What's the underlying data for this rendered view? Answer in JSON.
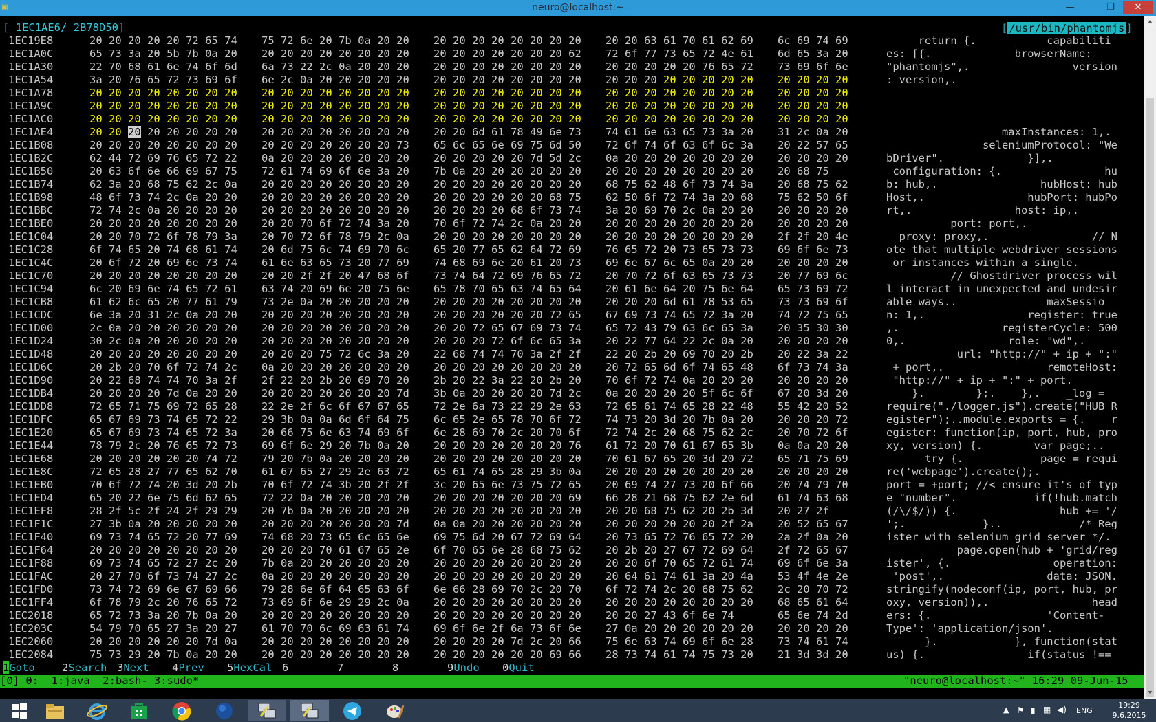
{
  "window": {
    "title": "neuro@localhost:~",
    "minimize_glyph": "—",
    "maximize_glyph": "❐",
    "close_glyph": "✕"
  },
  "header": {
    "open_bracket": "[",
    "cursor_offset": "1EC1AE6/",
    "file_size": "2B78D50",
    "close_bracket": "]",
    "path_bracket": "[",
    "file_path": "/usr/bin/phantomjs",
    "path_bracket_close": "]"
  },
  "hex_rows": [
    {
      "addr": "1EC19E8",
      "g": [
        "20 20 20 20 20 72 65 74",
        "75 72 6e 20 7b 0a 20 20",
        "20 20 20 20 20 20 20 20",
        "20 20 63 61 70 61 62 69",
        "6c 69 74 69"
      ],
      "ascii": "     return {.           capabiliti"
    },
    {
      "addr": "1EC1A0C",
      "g": [
        "65 73 3a 20 5b 7b 0a 20",
        "20 20 20 20 20 20 20 20",
        "20 20 20 20 20 20 20 62",
        "72 6f 77 73 65 72 4e 61",
        "6d 65 3a 20"
      ],
      "ascii": "es: [{.             browserName: "
    },
    {
      "addr": "1EC1A30",
      "g": [
        "22 70 68 61 6e 74 6f 6d",
        "6a 73 22 2c 0a 20 20 20",
        "20 20 20 20 20 20 20 20",
        "20 20 20 20 20 76 65 72",
        "73 69 6f 6e"
      ],
      "ascii": "\"phantomjs\",.                version"
    },
    {
      "addr": "1EC1A54",
      "g": [
        "3a 20 76 65 72 73 69 6f",
        "6e 2c 0a 20 20 20 20 20",
        "20 20 20 20 20 20 20 20",
        "20 20 20 20 20 20 20 20",
        "20 20 20 20"
      ],
      "ascii": ": version,.                        ",
      "hi": [
        27,
        28,
        29,
        30,
        31,
        32,
        33,
        34,
        35
      ]
    },
    {
      "addr": "1EC1A78",
      "g": [
        "20 20 20 20 20 20 20 20",
        "20 20 20 20 20 20 20 20",
        "20 20 20 20 20 20 20 20",
        "20 20 20 20 20 20 20 20",
        "20 20 20 20"
      ],
      "ascii": "",
      "allhi": true
    },
    {
      "addr": "1EC1A9C",
      "g": [
        "20 20 20 20 20 20 20 20",
        "20 20 20 20 20 20 20 20",
        "20 20 20 20 20 20 20 20",
        "20 20 20 20 20 20 20 20",
        "20 20 20 20"
      ],
      "ascii": "",
      "allhi": true
    },
    {
      "addr": "1EC1AC0",
      "g": [
        "20 20 20 20 20 20 20 20",
        "20 20 20 20 20 20 20 20",
        "20 20 20 20 20 20 20 20",
        "20 20 20 20 20 20 20 20",
        "20 20 20 20"
      ],
      "ascii": "",
      "allhi": true
    },
    {
      "addr": "1EC1AE4",
      "g": [
        "20 20 20 20 20 20 20 20",
        "20 20 20 20 20 20 20 20",
        "20 20 6d 61 78 49 6e 73",
        "74 61 6e 63 65 73 3a 20",
        "31 2c 0a 20"
      ],
      "ascii": "                  maxInstances: 1,.",
      "hi": [
        0,
        1
      ],
      "cursor": 2
    },
    {
      "addr": "1EC1B08",
      "g": [
        "20 20 20 20 20 20 20 20",
        "20 20 20 20 20 20 20 73",
        "65 6c 65 6e 69 75 6d 50",
        "72 6f 74 6f 63 6f 6c 3a",
        "20 22 57 65"
      ],
      "ascii": "               seleniumProtocol: \"We"
    },
    {
      "addr": "1EC1B2C",
      "g": [
        "62 44 72 69 76 65 72 22",
        "0a 20 20 20 20 20 20 20",
        "20 20 20 20 20 7d 5d 2c",
        "0a 20 20 20 20 20 20 20",
        "20 20 20 20"
      ],
      "ascii": "bDriver\".             }],."
    },
    {
      "addr": "1EC1B50",
      "g": [
        "20 63 6f 6e 66 69 67 75",
        "72 61 74 69 6f 6e 3a 20",
        "7b 0a 20 20 20 20 20 20",
        "20 20 20 20 20 20 20 20",
        "20 68 75"
      ],
      "ascii": " configuration: {.                hu"
    },
    {
      "addr": "1EC1B74",
      "g": [
        "62 3a 20 68 75 62 2c 0a",
        "20 20 20 20 20 20 20 20",
        "20 20 20 20 20 20 20 20",
        "68 75 62 48 6f 73 74 3a",
        "20 68 75 62"
      ],
      "ascii": "b: hub,.                hubHost: hub"
    },
    {
      "addr": "1EC1B98",
      "g": [
        "48 6f 73 74 2c 0a 20 20",
        "20 20 20 20 20 20 20 20",
        "20 20 20 20 20 20 68 75",
        "62 50 6f 72 74 3a 20 68",
        "75 62 50 6f"
      ],
      "ascii": "Host,.                hubPort: hubPo"
    },
    {
      "addr": "1EC1BBC",
      "g": [
        "72 74 2c 0a 20 20 20 20",
        "20 20 20 20 20 20 20 20",
        "20 20 20 20 68 6f 73 74",
        "3a 20 69 70 2c 0a 20 20",
        "20 20 20 20"
      ],
      "ascii": "rt,.                host: ip,."
    },
    {
      "addr": "1EC1BE0",
      "g": [
        "20 20 20 20 20 20 20 20",
        "20 20 70 6f 72 74 3a 20",
        "70 6f 72 74 2c 0a 20 20",
        "20 20 20 20 20 20 20 20",
        "20 20 20 20"
      ],
      "ascii": "          port: port,."
    },
    {
      "addr": "1EC1C04",
      "g": [
        "20 20 70 72 6f 78 79 3a",
        "20 70 72 6f 78 79 2c 0a",
        "20 20 20 20 20 20 20 20",
        "20 20 20 20 20 20 20 20",
        "2f 2f 20 4e"
      ],
      "ascii": "  proxy: proxy,.                // N"
    },
    {
      "addr": "1EC1C28",
      "g": [
        "6f 74 65 20 74 68 61 74",
        "20 6d 75 6c 74 69 70 6c",
        "65 20 77 65 62 64 72 69",
        "76 65 72 20 73 65 73 73",
        "69 6f 6e 73"
      ],
      "ascii": "ote that multiple webdriver sessions"
    },
    {
      "addr": "1EC1C4C",
      "g": [
        "20 6f 72 20 69 6e 73 74",
        "61 6e 63 65 73 20 77 69",
        "74 68 69 6e 20 61 20 73",
        "69 6e 67 6c 65 0a 20 20",
        "20 20 20 20"
      ],
      "ascii": " or instances within a single."
    },
    {
      "addr": "1EC1C70",
      "g": [
        "20 20 20 20 20 20 20 20",
        "20 20 2f 2f 20 47 68 6f",
        "73 74 64 72 69 76 65 72",
        "20 70 72 6f 63 65 73 73",
        "20 77 69 6c"
      ],
      "ascii": "          // Ghostdriver process wil"
    },
    {
      "addr": "1EC1C94",
      "g": [
        "6c 20 69 6e 74 65 72 61",
        "63 74 20 69 6e 20 75 6e",
        "65 78 70 65 63 74 65 64",
        "20 61 6e 64 20 75 6e 64",
        "65 73 69 72"
      ],
      "ascii": "l interact in unexpected and undesir"
    },
    {
      "addr": "1EC1CB8",
      "g": [
        "61 62 6c 65 20 77 61 79",
        "73 2e 0a 20 20 20 20 20",
        "20 20 20 20 20 20 20 20",
        "20 20 20 6d 61 78 53 65",
        "73 73 69 6f"
      ],
      "ascii": "able ways..              maxSessio"
    },
    {
      "addr": "1EC1CDC",
      "g": [
        "6e 3a 20 31 2c 0a 20 20",
        "20 20 20 20 20 20 20 20",
        "20 20 20 20 20 20 72 65",
        "67 69 73 74 65 72 3a 20",
        "74 72 75 65"
      ],
      "ascii": "n: 1,.                register: true"
    },
    {
      "addr": "1EC1D00",
      "g": [
        "2c 0a 20 20 20 20 20 20",
        "20 20 20 20 20 20 20 20",
        "20 20 72 65 67 69 73 74",
        "65 72 43 79 63 6c 65 3a",
        "20 35 30 30"
      ],
      "ascii": ",.                registerCycle: 500"
    },
    {
      "addr": "1EC1D24",
      "g": [
        "30 2c 0a 20 20 20 20 20",
        "20 20 20 20 20 20 20 20",
        "20 20 20 72 6f 6c 65 3a",
        "20 22 77 64 22 2c 0a 20",
        "20 20 20 20"
      ],
      "ascii": "0,.                role: \"wd\",."
    },
    {
      "addr": "1EC1D48",
      "g": [
        "20 20 20 20 20 20 20 20",
        "20 20 20 75 72 6c 3a 20",
        "22 68 74 74 70 3a 2f 2f",
        "22 20 2b 20 69 70 20 2b",
        "20 22 3a 22"
      ],
      "ascii": "           url: \"http://\" + ip + \":\""
    },
    {
      "addr": "1EC1D6C",
      "g": [
        "20 2b 20 70 6f 72 74 2c",
        "0a 20 20 20 20 20 20 20",
        "20 20 20 20 20 20 20 20",
        "20 72 65 6d 6f 74 65 48",
        "6f 73 74 3a"
      ],
      "ascii": " + port,.                remoteHost:"
    },
    {
      "addr": "1EC1D90",
      "g": [
        "20 22 68 74 74 70 3a 2f",
        "2f 22 20 2b 20 69 70 20",
        "2b 20 22 3a 22 20 2b 20",
        "70 6f 72 74 0a 20 20 20",
        "20 20 20 20"
      ],
      "ascii": " \"http://\" + ip + \":\" + port."
    },
    {
      "addr": "1EC1DB4",
      "g": [
        "20 20 20 20 7d 0a 20 20",
        "20 20 20 20 20 20 20 7d",
        "3b 0a 20 20 20 20 7d 2c",
        "0a 20 20 20 20 5f 6c 6f",
        "67 20 3d 20"
      ],
      "ascii": "    }.        };.    },.    _log ="
    },
    {
      "addr": "1EC1DD8",
      "g": [
        "72 65 71 75 69 72 65 28",
        "22 2e 2f 6c 6f 67 67 65",
        "72 2e 6a 73 22 29 2e 63",
        "72 65 61 74 65 28 22 48",
        "55 42 20 52"
      ],
      "ascii": "require(\"./logger.js\").create(\"HUB R"
    },
    {
      "addr": "1EC1DFC",
      "g": [
        "65 67 69 73 74 65 72 22",
        "29 3b 0a 0a 6d 6f 64 75",
        "6c 65 2e 65 78 70 6f 72",
        "74 73 20 3d 20 7b 0a 20",
        "20 20 20 72"
      ],
      "ascii": "egister\");..module.exports = {.    r"
    },
    {
      "addr": "1EC1E20",
      "g": [
        "65 67 69 73 74 65 72 3a",
        "20 66 75 6e 63 74 69 6f",
        "6e 28 69 70 2c 20 70 6f",
        "72 74 2c 20 68 75 62 2c",
        "20 70 72 6f"
      ],
      "ascii": "egister: function(ip, port, hub, pro"
    },
    {
      "addr": "1EC1E44",
      "g": [
        "78 79 2c 20 76 65 72 73",
        "69 6f 6e 29 20 7b 0a 20",
        "20 20 20 20 20 20 20 76",
        "61 72 20 70 61 67 65 3b",
        "0a 0a 20 20"
      ],
      "ascii": "xy, version) {.        var page;.."
    },
    {
      "addr": "1EC1E68",
      "g": [
        "20 20 20 20 20 20 74 72",
        "79 20 7b 0a 20 20 20 20",
        "20 20 20 20 20 20 20 20",
        "70 61 67 65 20 3d 20 72",
        "65 71 75 69"
      ],
      "ascii": "      try {.            page = requi"
    },
    {
      "addr": "1EC1E8C",
      "g": [
        "72 65 28 27 77 65 62 70",
        "61 67 65 27 29 2e 63 72",
        "65 61 74 65 28 29 3b 0a",
        "20 20 20 20 20 20 20 20",
        "20 20 20 20"
      ],
      "ascii": "re('webpage').create();."
    },
    {
      "addr": "1EC1EB0",
      "g": [
        "70 6f 72 74 20 3d 20 2b",
        "70 6f 72 74 3b 20 2f 2f",
        "3c 20 65 6e 73 75 72 65",
        "20 69 74 27 73 20 6f 66",
        "20 74 79 70"
      ],
      "ascii": "port = +port; //< ensure it's of typ"
    },
    {
      "addr": "1EC1ED4",
      "g": [
        "65 20 22 6e 75 6d 62 65",
        "72 22 0a 20 20 20 20 20",
        "20 20 20 20 20 20 20 69",
        "66 28 21 68 75 62 2e 6d",
        "61 74 63 68"
      ],
      "ascii": "e \"number\".            if(!hub.match"
    },
    {
      "addr": "1EC1EF8",
      "g": [
        "28 2f 5c 2f 24 2f 29 29",
        "20 7b 0a 20 20 20 20 20",
        "20 20 20 20 20 20 20 20",
        "20 20 68 75 62 20 2b 3d",
        "20 27 2f"
      ],
      "ascii": "(/\\/$/)) {.                hub += '/"
    },
    {
      "addr": "1EC1F1C",
      "g": [
        "27 3b 0a 20 20 20 20 20",
        "20 20 20 20 20 20 20 7d",
        "0a 0a 20 20 20 20 20 20",
        "20 20 20 20 20 20 2f 2a",
        "20 52 65 67"
      ],
      "ascii": "';.            }..            /* Reg"
    },
    {
      "addr": "1EC1F40",
      "g": [
        "69 73 74 65 72 20 77 69",
        "74 68 20 73 65 6c 65 6e",
        "69 75 6d 20 67 72 69 64",
        "20 73 65 72 76 65 72 20",
        "2a 2f 0a 20"
      ],
      "ascii": "ister with selenium grid server */."
    },
    {
      "addr": "1EC1F64",
      "g": [
        "20 20 20 20 20 20 20 20",
        "20 20 20 70 61 67 65 2e",
        "6f 70 65 6e 28 68 75 62",
        "20 2b 20 27 67 72 69 64",
        "2f 72 65 67"
      ],
      "ascii": "           page.open(hub + 'grid/reg"
    },
    {
      "addr": "1EC1F88",
      "g": [
        "69 73 74 65 72 27 2c 20",
        "7b 0a 20 20 20 20 20 20",
        "20 20 20 20 20 20 20 20",
        "20 20 6f 70 65 72 61 74",
        "69 6f 6e 3a"
      ],
      "ascii": "ister', {.                operation:"
    },
    {
      "addr": "1EC1FAC",
      "g": [
        "20 27 70 6f 73 74 27 2c",
        "0a 20 20 20 20 20 20 20",
        "20 20 20 20 20 20 20 20",
        "20 64 61 74 61 3a 20 4a",
        "53 4f 4e 2e"
      ],
      "ascii": " 'post',.                data: JSON."
    },
    {
      "addr": "1EC1FD0",
      "g": [
        "73 74 72 69 6e 67 69 66",
        "79 28 6e 6f 64 65 63 6f",
        "6e 66 28 69 70 2c 20 70",
        "6f 72 74 2c 20 68 75 62",
        "2c 20 70 72"
      ],
      "ascii": "stringify(nodeconf(ip, port, hub, pr"
    },
    {
      "addr": "1EC1FF4",
      "g": [
        "6f 78 79 2c 20 76 65 72",
        "73 69 6f 6e 29 29 2c 0a",
        "20 20 20 20 20 20 20 20",
        "20 20 20 20 20 20 20 20",
        "68 65 61 64"
      ],
      "ascii": "oxy, version)),.                head"
    },
    {
      "addr": "1EC2018",
      "g": [
        "65 72 73 3a 20 7b 0a 20",
        "20 20 20 20 20 20 20 20",
        "20 20 20 20 20 20 20 20",
        "20 20 27 43 6f 6e 74",
        "65 6e 74 2d"
      ],
      "ascii": "ers: {.                  'Content-"
    },
    {
      "addr": "1EC203C",
      "g": [
        "54 79 70 65 27 3a 20 27",
        "61 70 70 6c 69 63 61 74",
        "69 6f 6e 2f 6a 73 6f 6e",
        "27 0a 20 20 20 20 20 20",
        "20 20 20 20"
      ],
      "ascii": "Type': 'application/json'."
    },
    {
      "addr": "1EC2060",
      "g": [
        "20 20 20 20 20 20 7d 0a",
        "20 20 20 20 20 20 20 20",
        "20 20 20 20 7d 2c 20 66",
        "75 6e 63 74 69 6f 6e 28",
        "73 74 61 74"
      ],
      "ascii": "      }.            }, function(stat"
    },
    {
      "addr": "1EC2084",
      "g": [
        "75 73 29 20 7b 0a 20 20",
        "20 20 20 20 20 20 20 20",
        "20 20 20 20 20 20 69 66",
        "28 73 74 61 74 75 73 20",
        "21 3d 3d 20"
      ],
      "ascii": "us) {.                if(status !== "
    }
  ],
  "fkeys": [
    {
      "n": "1",
      "label": "Goto"
    },
    {
      "n": "2",
      "label": "Search"
    },
    {
      "n": "3",
      "label": "Next"
    },
    {
      "n": "4",
      "label": "Prev"
    },
    {
      "n": "5",
      "label": "HexCal"
    },
    {
      "n": "6",
      "label": ""
    },
    {
      "n": "7",
      "label": ""
    },
    {
      "n": "8",
      "label": ""
    },
    {
      "n": "9",
      "label": "Undo"
    },
    {
      "n": "0",
      "label": "Quit"
    }
  ],
  "status_bar": {
    "left": "[0] 0:  1:java  2:bash- 3:sudo*",
    "right": "\"neuro@localhost:~\" 16:29 09-Jun-15"
  },
  "taskbar": {
    "apps": [
      "start-icon",
      "file-explorer-icon",
      "internet-explorer-icon",
      "store-icon",
      "chrome-icon",
      "globe-icon",
      "putty-icon",
      "putty-icon-active",
      "telegram-icon",
      "paint-icon"
    ],
    "lang": "ENG",
    "time": "19:29",
    "date": "9.6.2015"
  }
}
